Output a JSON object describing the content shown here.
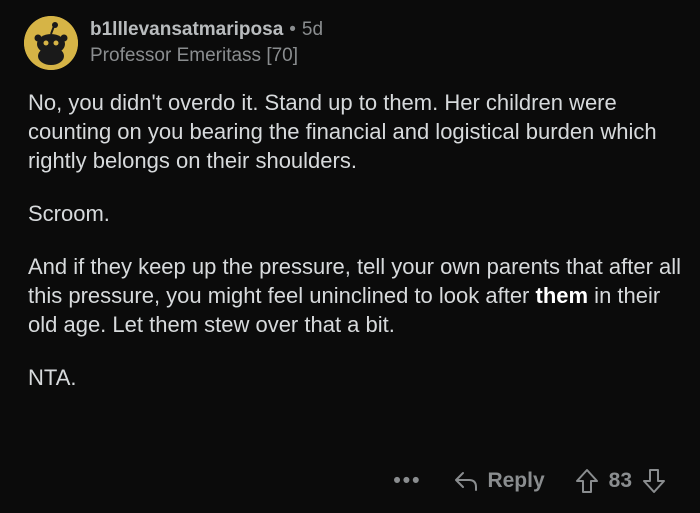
{
  "comment": {
    "username": "b1lllevansatmariposa",
    "separator": "•",
    "age": "5d",
    "flair": "Professor Emeritass [70]",
    "paragraphs": {
      "p1": "No, you didn't overdo it. Stand up to them. Her children were counting on you bearing the financial and logistical burden which rightly belongs on their shoulders.",
      "p2": "Scroom.",
      "p3_before": "And if they keep up the pressure, tell your own parents that after all this pressure, you might feel uninclined to look after ",
      "p3_bold": "them",
      "p3_after": " in their old age. Let them stew over that a bit.",
      "p4": "NTA."
    }
  },
  "actions": {
    "more": "•••",
    "reply": "Reply",
    "score": "83"
  },
  "icons": {
    "avatar": "snoo-avatar-icon",
    "reply": "reply-arrow-icon",
    "upvote": "upvote-arrow-icon",
    "downvote": "downvote-arrow-icon"
  },
  "colors": {
    "background": "#0b0b0b",
    "text": "#d7dadc",
    "muted": "#8a8d8f",
    "avatar": "#d6b446"
  }
}
